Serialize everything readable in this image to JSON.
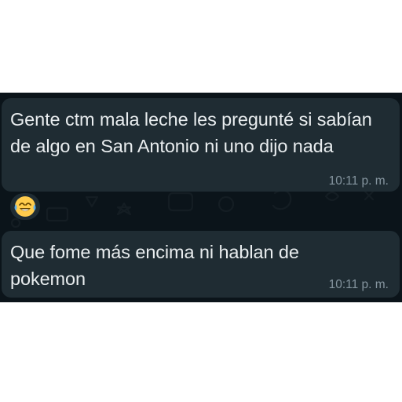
{
  "messages": [
    {
      "text": "Gente ctm mala leche les pregunté si sabían de algo en San Antonio ni uno dijo nada",
      "time": "10:11 p. m.",
      "reaction": "face-with-tears-of-joy-icon"
    },
    {
      "text": "Que fome más encima ni hablan de pokemon",
      "time": "10:11 p. m."
    }
  ],
  "colors": {
    "chat_background": "#0b141a",
    "bubble": "#1f2c33",
    "text": "#e9edef",
    "timestamp": "#8696a0"
  }
}
